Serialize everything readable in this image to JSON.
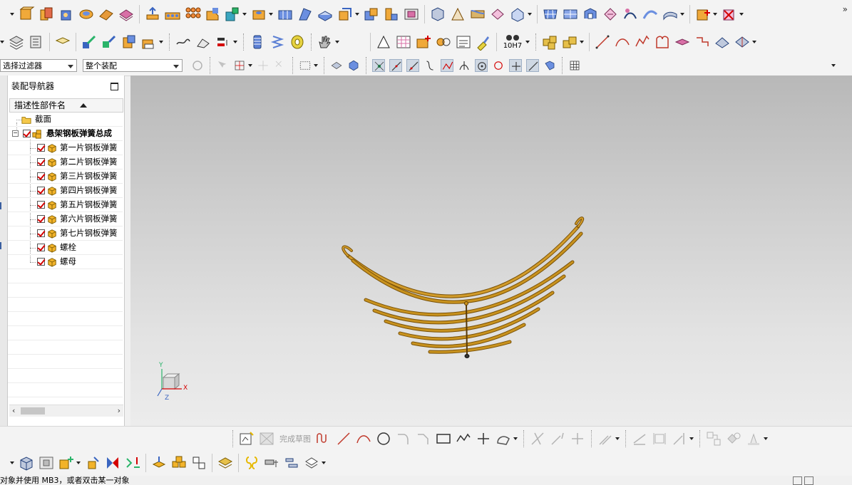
{
  "filters": {
    "selection_filter": "选择过滤器",
    "assembly_scope": "整个装配"
  },
  "navigator": {
    "title": "装配导航器",
    "column_header": "描述性部件名",
    "items": [
      {
        "label": "截面",
        "type": "folder",
        "level": 1
      },
      {
        "label": "悬架钢板弹簧总成",
        "type": "assembly",
        "level": 1,
        "bold": true
      },
      {
        "label": "第一片钢板弹簧",
        "type": "part",
        "level": 2
      },
      {
        "label": "第二片钢板弹簧",
        "type": "part",
        "level": 2
      },
      {
        "label": "第三片钢板弹簧",
        "type": "part",
        "level": 2
      },
      {
        "label": "第四片钢板弹簧",
        "type": "part",
        "level": 2
      },
      {
        "label": "第五片钢板弹簧",
        "type": "part",
        "level": 2
      },
      {
        "label": "第六片钢板弹簧",
        "type": "part",
        "level": 2
      },
      {
        "label": "第七片钢板弹簧",
        "type": "part",
        "level": 2
      },
      {
        "label": "螺栓",
        "type": "part",
        "level": 2
      },
      {
        "label": "螺母",
        "type": "part",
        "level": 2
      }
    ]
  },
  "toolbar": {
    "dimension_label": "10H7",
    "finish_sketch_label": "完成草图",
    "overflow": "»"
  },
  "viewport": {
    "axis_x": "X",
    "axis_y": "Y",
    "axis_z": "Z"
  },
  "status": {
    "message": "对象并使用 MB3，或者双击某一对象"
  },
  "colors": {
    "spring_leaf": "#c8921e",
    "spring_edge": "#7a5208",
    "check_mark": "#d40000",
    "part_cube": "#f2b32a"
  }
}
